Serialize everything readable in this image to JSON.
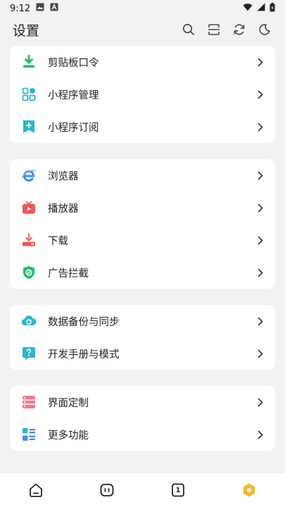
{
  "status_bar": {
    "time": "9:12"
  },
  "header": {
    "title": "设置"
  },
  "groups": [
    {
      "items": [
        {
          "label": "剪贴板口令",
          "icon": "clipboard-download-icon"
        },
        {
          "label": "小程序管理",
          "icon": "apps-grid-icon"
        },
        {
          "label": "小程序订阅",
          "icon": "bookmark-plus-icon"
        }
      ]
    },
    {
      "items": [
        {
          "label": "浏览器",
          "icon": "browser-e-icon"
        },
        {
          "label": "播放器",
          "icon": "tv-play-icon"
        },
        {
          "label": "下载",
          "icon": "download-icon"
        },
        {
          "label": "广告拦截",
          "icon": "ad-block-shield-icon"
        }
      ]
    },
    {
      "items": [
        {
          "label": "数据备份与同步",
          "icon": "cloud-sync-icon"
        },
        {
          "label": "开发手册与模式",
          "icon": "help-bubble-icon"
        }
      ]
    },
    {
      "items": [
        {
          "label": "界面定制",
          "icon": "layout-icon"
        },
        {
          "label": "更多功能",
          "icon": "more-list-icon"
        }
      ]
    }
  ],
  "bottom_nav": {
    "tab_count": "1"
  },
  "colors": {
    "green": "#1fbf6a",
    "teal": "#2bb7c9",
    "blue": "#3f8ef0",
    "red": "#f05555",
    "pink": "#f07a8f",
    "yellow": "#f5b82e"
  }
}
